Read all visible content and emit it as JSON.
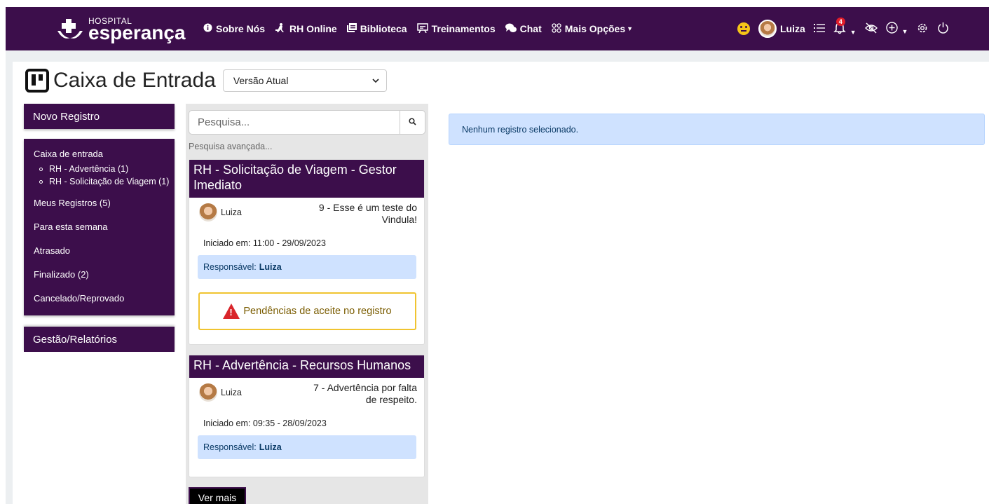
{
  "navbar": {
    "brand_small": "HOSPITAL",
    "brand_big": "esperança",
    "links": [
      {
        "label": "Sobre Nós",
        "icon": "info-circle-icon"
      },
      {
        "label": "RH Online",
        "icon": "person-carry-icon"
      },
      {
        "label": "Biblioteca",
        "icon": "library-icon"
      },
      {
        "label": "Treinamentos",
        "icon": "training-icon"
      },
      {
        "label": "Chat",
        "icon": "chat-icon"
      },
      {
        "label": "Mais Opções",
        "icon": "grid-icon"
      }
    ],
    "user_name": "Luiza",
    "notification_count": "4",
    "bg_color": "#3c0e4b"
  },
  "page": {
    "title": "Caixa de Entrada",
    "version_select": "Versão Atual"
  },
  "sidebar": {
    "new_record": "Novo Registro",
    "items": [
      {
        "label": "Caixa de entrada"
      },
      {
        "label": "Meus Registros (5)"
      },
      {
        "label": "Para esta semana"
      },
      {
        "label": "Atrasado"
      },
      {
        "label": "Finalizado (2)"
      },
      {
        "label": "Cancelado/Reprovado"
      }
    ],
    "sub_items": [
      {
        "label": "RH - Advertência (1)"
      },
      {
        "label": "RH - Solicitação de Viagem (1)"
      }
    ],
    "management": "Gestão/Relatórios"
  },
  "search": {
    "placeholder": "Pesquisa...",
    "advanced": "Pesquisa avançada..."
  },
  "cards": [
    {
      "title": "RH - Solicitação de Viagem - Gestor Imediato",
      "user": "Luiza",
      "description": "9 - Esse é um teste do Vindula!",
      "started": "Iniciado em: 11:00 - 29/09/2023",
      "resp_label": "Responsável:",
      "resp_name": "Luiza",
      "warning": "Pendências de aceite no registro"
    },
    {
      "title": "RH - Advertência - Recursos Humanos",
      "user": "Luiza",
      "description": "7 - Advertência por falta de respeito.",
      "started": "Iniciado em: 09:35 - 28/09/2023",
      "resp_label": "Responsável:",
      "resp_name": "Luiza"
    }
  ],
  "more_button": "Ver mais",
  "detail": {
    "empty_message": "Nenhum registro selecionado."
  }
}
